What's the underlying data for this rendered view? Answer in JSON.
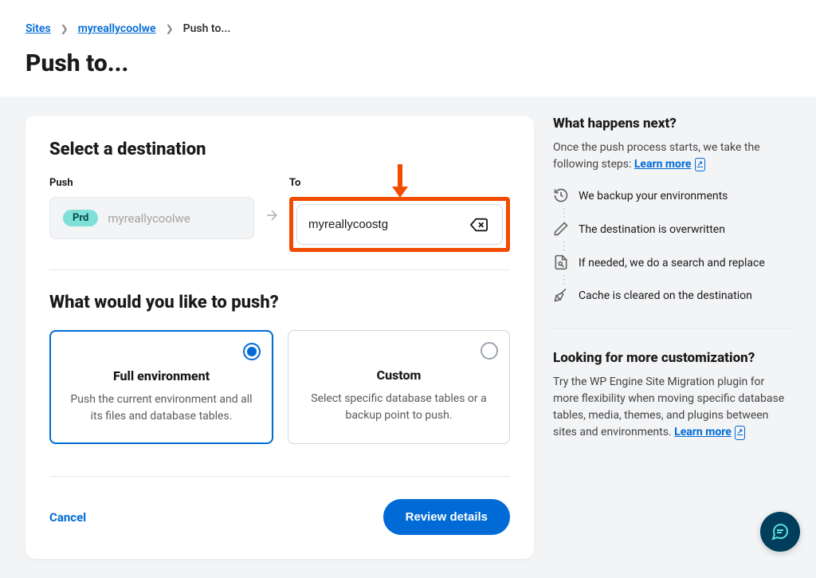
{
  "breadcrumb": {
    "sites": "Sites",
    "site": "myreallycoolwe",
    "current": "Push to..."
  },
  "page_title": "Push to...",
  "destination": {
    "heading": "Select a destination",
    "push_label": "Push",
    "to_label": "To",
    "source_badge": "Prd",
    "source_name": "myreallycoolwe",
    "dest_value": "myreallycoostg"
  },
  "push_what": {
    "heading": "What would you like to push?",
    "full": {
      "title": "Full environment",
      "desc": "Push the current environment and all its files and database tables."
    },
    "custom": {
      "title": "Custom",
      "desc": "Select specific database tables or a backup point to push."
    }
  },
  "footer": {
    "cancel": "Cancel",
    "review": "Review details"
  },
  "sidebar": {
    "whn_title": "What happens next?",
    "whn_desc": "Once the push process starts, we take the following steps:  ",
    "learn_more": "Learn more",
    "steps": [
      "We backup your environments",
      "The destination is overwritten",
      "If needed, we do a search and replace",
      "Cache is cleared on the destination"
    ],
    "custom_title": "Looking for more customization?",
    "custom_desc": "Try the WP Engine Site Migration plugin for more flexibility when moving specific database tables, media, themes, and plugins between sites and environments.  "
  }
}
